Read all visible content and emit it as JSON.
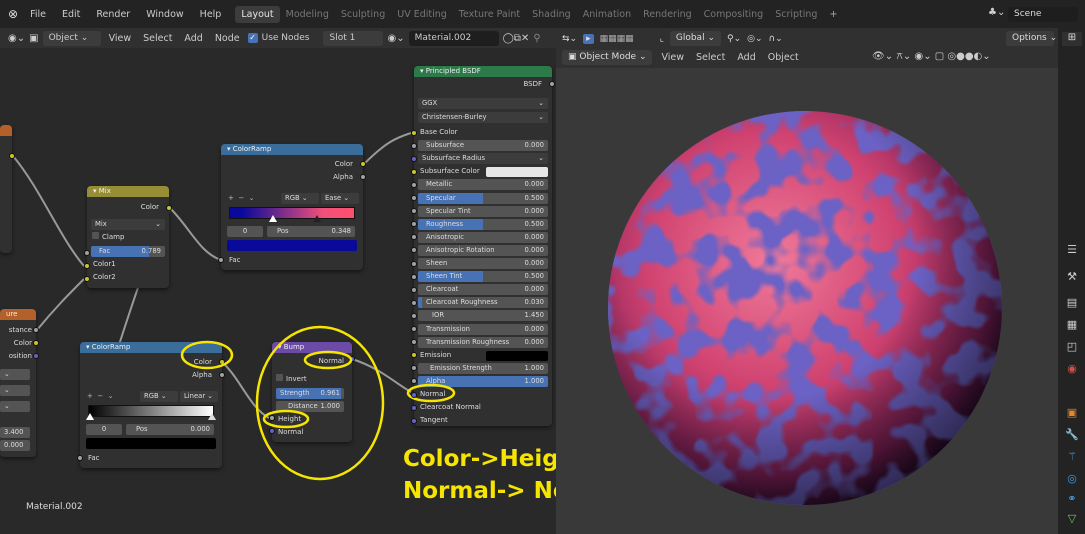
{
  "topbar": {
    "menus": [
      "File",
      "Edit",
      "Render",
      "Window",
      "Help"
    ],
    "workspaces": [
      "Layout",
      "Modeling",
      "Sculpting",
      "UV Editing",
      "Texture Paint",
      "Shading",
      "Animation",
      "Rendering",
      "Compositing",
      "Scripting"
    ],
    "add_tab": "+",
    "scene": "Scene"
  },
  "node_header": {
    "object": "Object",
    "view": "View",
    "select": "Select",
    "add": "Add",
    "node": "Node",
    "use_nodes": "Use Nodes",
    "slot": "Slot 1",
    "material": "Material.002"
  },
  "viewport_header": {
    "global": "Global",
    "options": "Options",
    "mode": "Object Mode",
    "view": "View",
    "select": "Select",
    "add": "Add",
    "object": "Object"
  },
  "nodes": {
    "principled": {
      "title": "Principled BSDF",
      "output": "BSDF",
      "distribution": "GGX",
      "subsurface_method": "Christensen-Burley",
      "inputs": [
        {
          "label": "Base Color",
          "kind": "socket",
          "sock": "y"
        },
        {
          "label": "Subsurface",
          "value": "0.000",
          "kind": "field",
          "fill": 0
        },
        {
          "label": "Subsurface Radius",
          "kind": "dropdown",
          "sock": "pu"
        },
        {
          "label": "Subsurface Color",
          "kind": "color",
          "color": "#e6e6e6",
          "sock": "y"
        },
        {
          "label": "Metallic",
          "value": "0.000",
          "kind": "field",
          "fill": 0
        },
        {
          "label": "Specular",
          "value": "0.500",
          "kind": "field",
          "fill": 0.5
        },
        {
          "label": "Specular Tint",
          "value": "0.000",
          "kind": "field",
          "fill": 0
        },
        {
          "label": "Roughness",
          "value": "0.500",
          "kind": "field",
          "fill": 0.5
        },
        {
          "label": "Anisotropic",
          "value": "0.000",
          "kind": "field",
          "fill": 0
        },
        {
          "label": "Anisotropic Rotation",
          "value": "0.000",
          "kind": "field",
          "fill": 0
        },
        {
          "label": "Sheen",
          "value": "0.000",
          "kind": "field",
          "fill": 0
        },
        {
          "label": "Sheen Tint",
          "value": "0.500",
          "kind": "field",
          "fill": 0.5
        },
        {
          "label": "Clearcoat",
          "value": "0.000",
          "kind": "field",
          "fill": 0
        },
        {
          "label": "Clearcoat Roughness",
          "value": "0.030",
          "kind": "field",
          "fill": 0.03
        },
        {
          "label": "IOR",
          "value": "1.450",
          "kind": "field",
          "fill": 0
        },
        {
          "label": "Transmission",
          "value": "0.000",
          "kind": "field",
          "fill": 0
        },
        {
          "label": "Transmission Roughness",
          "value": "0.000",
          "kind": "field",
          "fill": 0
        },
        {
          "label": "Emission",
          "kind": "color",
          "color": "#000000",
          "sock": "y"
        },
        {
          "label": "Emission Strength",
          "value": "1.000",
          "kind": "field",
          "fill": 0
        },
        {
          "label": "Alpha",
          "value": "1.000",
          "kind": "field",
          "fill": 1
        },
        {
          "label": "Normal",
          "kind": "socket",
          "sock": "pu"
        },
        {
          "label": "Clearcoat Normal",
          "kind": "socket",
          "sock": "pu"
        },
        {
          "label": "Tangent",
          "kind": "socket",
          "sock": "pu"
        }
      ]
    },
    "colorramp_top": {
      "title": "ColorRamp",
      "out_color": "Color",
      "out_alpha": "Alpha",
      "mode": "RGB",
      "interp": "Ease",
      "index": "0",
      "pos_label": "Pos",
      "pos": "0.348",
      "stop_color": "#0a0a9a",
      "fac": "Fac"
    },
    "mix": {
      "title": "Mix",
      "output": "Color",
      "blend": "Mix",
      "clamp": "Clamp",
      "fac_label": "Fac",
      "fac": "0.789",
      "color1": "Color1",
      "color2": "Color2"
    },
    "colorramp_bottom": {
      "title": "ColorRamp",
      "out_color": "Color",
      "out_alpha": "Alpha",
      "mode": "RGB",
      "interp": "Linear",
      "index": "0",
      "pos_label": "Pos",
      "pos": "0.000",
      "stop_color": "#000000",
      "fac": "Fac"
    },
    "bump": {
      "title": "Bump",
      "output": "Normal",
      "invert": "Invert",
      "strength_label": "Strength",
      "strength": "0.961",
      "distance_label": "Distance",
      "distance": "1.000",
      "height": "Height",
      "normal": "Normal"
    },
    "texture_partial": {
      "title": "ure",
      "out_distance": "stance",
      "out_color": "Color",
      "out_position": "osition",
      "v1": "3.400",
      "v2": "0.000"
    }
  },
  "material_label": "Material.002",
  "annotation": {
    "line1": "Color->Height",
    "line2": "Normal-> Normal"
  },
  "colors": {
    "accent_yellow": "#f5e500",
    "node_blue_header": "#3b6d9b",
    "mix_header": "#968e35",
    "bump_header": "#6b4ba6",
    "principled_header": "#2c7a4a",
    "selection": "#4772b3"
  }
}
